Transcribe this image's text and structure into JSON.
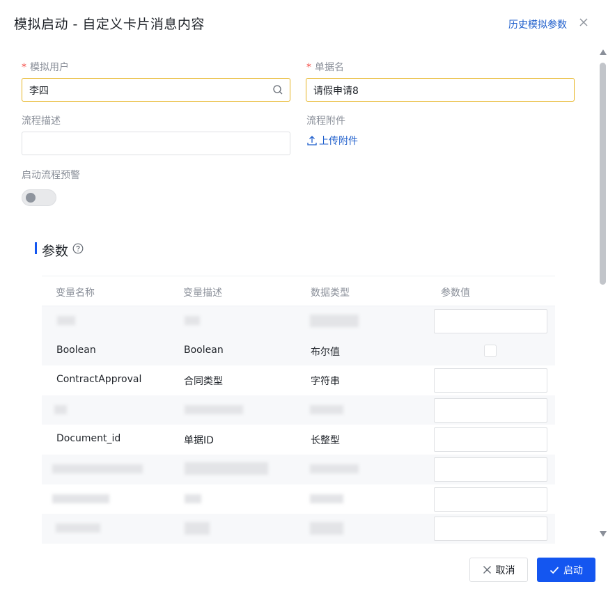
{
  "header": {
    "title": "模拟启动 - 自定义卡片消息内容",
    "history_link": "历史模拟参数"
  },
  "form": {
    "user": {
      "label": "模拟用户",
      "required_mark": "*",
      "value": "李四"
    },
    "doc_name": {
      "label": "单据名",
      "required_mark": "*",
      "value": "请假申请8"
    },
    "desc": {
      "label": "流程描述",
      "value": ""
    },
    "attachment": {
      "label": "流程附件",
      "upload_label": "上传附件"
    },
    "warning": {
      "label": "启动流程预警",
      "enabled": false
    }
  },
  "params": {
    "title": "参数",
    "columns": [
      "变量名称",
      "变量描述",
      "数据类型",
      "参数值"
    ],
    "rows": [
      {
        "name": "",
        "desc": "",
        "type": "",
        "value_kind": "input"
      },
      {
        "name": "Boolean",
        "desc": "Boolean",
        "type": "布尔值",
        "value_kind": "checkbox"
      },
      {
        "name": "ContractApproval",
        "desc": "合同类型",
        "type": "字符串",
        "value_kind": "input"
      },
      {
        "name": "",
        "desc": "",
        "type": "",
        "value_kind": "input"
      },
      {
        "name": "Document_id",
        "desc": "单据ID",
        "type": "长整型",
        "value_kind": "input"
      },
      {
        "name": "",
        "desc": "",
        "type": "",
        "value_kind": "input"
      },
      {
        "name": "",
        "desc": "",
        "type": "",
        "value_kind": "input"
      },
      {
        "name": "",
        "desc": "",
        "type": "",
        "value_kind": "input"
      }
    ]
  },
  "footer": {
    "cancel_label": "取消",
    "start_label": "启动"
  },
  "colors": {
    "primary": "#1456f0",
    "link": "#1f5fcc",
    "focus_border": "#e6b422",
    "required": "#f54a45"
  }
}
